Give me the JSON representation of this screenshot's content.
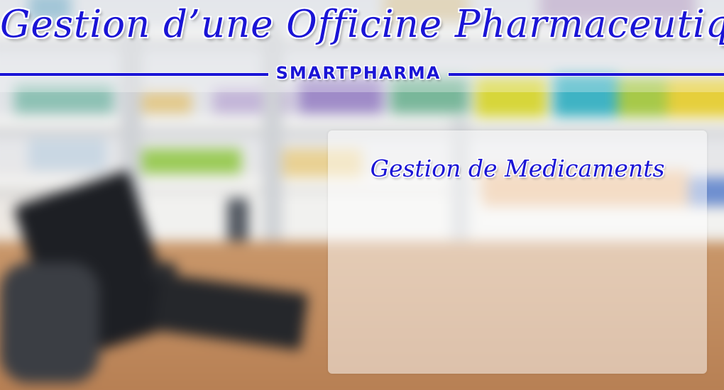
{
  "header": {
    "title": "Gestion d’une Officine Pharmaceutique",
    "brand": "SMARTPHARMA"
  },
  "panel": {
    "title": "Gestion de Medicaments"
  },
  "colors": {
    "accent": "#1a14d6",
    "outline": "#ffffff"
  }
}
